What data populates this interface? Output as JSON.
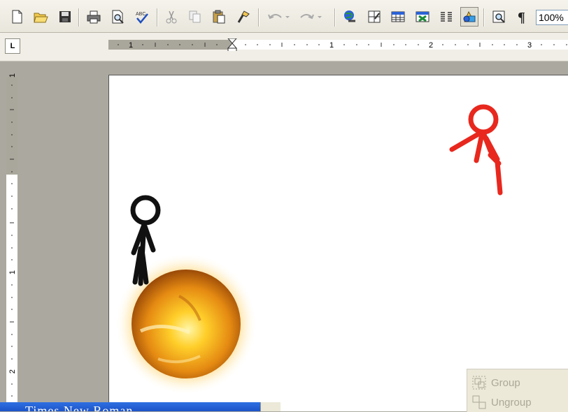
{
  "toolbar": {
    "buttons": [
      {
        "name": "new-document-icon"
      },
      {
        "name": "open-folder-icon"
      },
      {
        "name": "save-icon"
      },
      {
        "name": "print-icon"
      },
      {
        "name": "print-preview-icon"
      },
      {
        "name": "spelling-grammar-icon"
      },
      {
        "name": "cut-icon"
      },
      {
        "name": "copy-icon"
      },
      {
        "name": "paste-icon"
      },
      {
        "name": "format-painter-icon"
      },
      {
        "name": "undo-icon"
      },
      {
        "name": "redo-icon"
      },
      {
        "name": "insert-hyperlink-icon"
      },
      {
        "name": "tables-borders-icon"
      },
      {
        "name": "insert-table-icon"
      },
      {
        "name": "insert-excel-worksheet-icon"
      },
      {
        "name": "columns-icon"
      },
      {
        "name": "drawing-icon"
      },
      {
        "name": "document-map-icon"
      },
      {
        "name": "show-hide-paragraph-icon"
      }
    ],
    "zoom": "100%"
  },
  "ruler": {
    "tab_selector": "L",
    "h_labels": [
      "1",
      "1",
      "2",
      "3"
    ],
    "v_labels": [
      "1",
      "1",
      "2"
    ]
  },
  "group_panel": {
    "group_label": "Group",
    "ungroup_label": "Ungroup"
  },
  "title_bar": {
    "text": "Times New Roman"
  },
  "colors": {
    "toolbar_bg": "#ece9d8",
    "page_bg": "#ffffff",
    "workspace_bg": "#aba99f",
    "red_figure": "#e8281e",
    "fireball_core": "#f5a21a",
    "title_blue": "#2459d6"
  }
}
